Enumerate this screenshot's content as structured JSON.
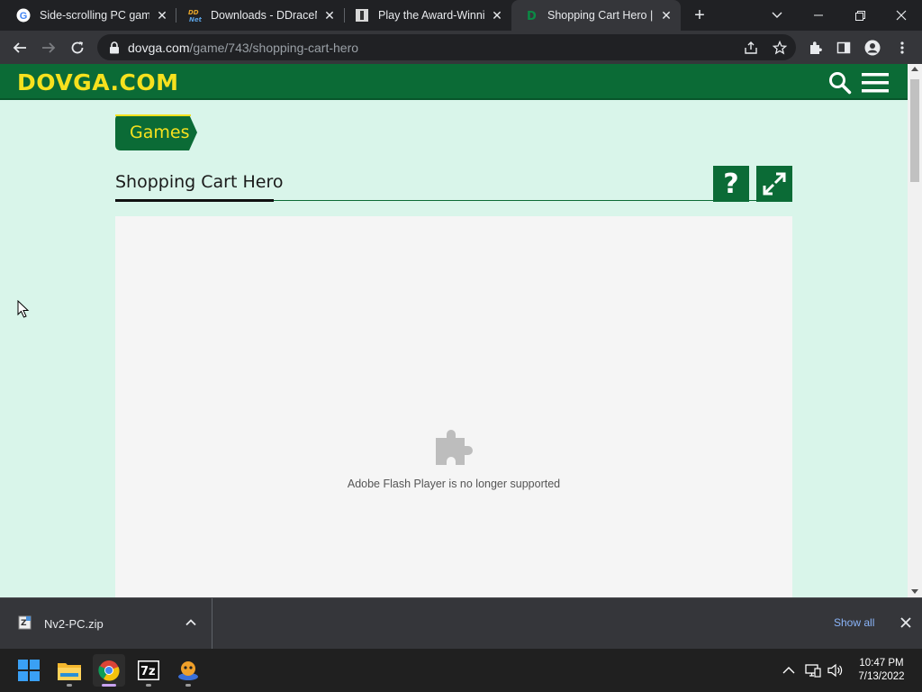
{
  "browser": {
    "tabs": [
      {
        "title": "Side-scrolling PC game",
        "favicon": "google-icon",
        "active": false
      },
      {
        "title": "Downloads - DDraceNet",
        "favicon": "ddnet-icon",
        "active": false
      },
      {
        "title": "Play the Award-Winning",
        "favicon": "game-icon",
        "active": false
      },
      {
        "title": "Shopping Cart Hero | d",
        "favicon": "dovga-icon",
        "active": true
      }
    ],
    "url_host": "dovga.com",
    "url_path": "/game/743/shopping-cart-hero"
  },
  "site": {
    "logo": "DOVGA.COM",
    "breadcrumb": "Games",
    "game_title": "Shopping Cart Hero",
    "help_label": "?",
    "flash_message": "Adobe Flash Player is no longer supported"
  },
  "downloads": {
    "file_name": "Nv2-PC.zip",
    "show_all": "Show all"
  },
  "taskbar": {
    "time": "10:47 PM",
    "date": "7/13/2022",
    "apps": [
      "windows-start-icon",
      "file-explorer-icon",
      "chrome-icon",
      "7zip-icon",
      "game-app-icon"
    ]
  },
  "colors": {
    "header_green": "#0b6b36",
    "logo_yellow": "#f6e11e",
    "page_bg": "#d9f5ea"
  }
}
